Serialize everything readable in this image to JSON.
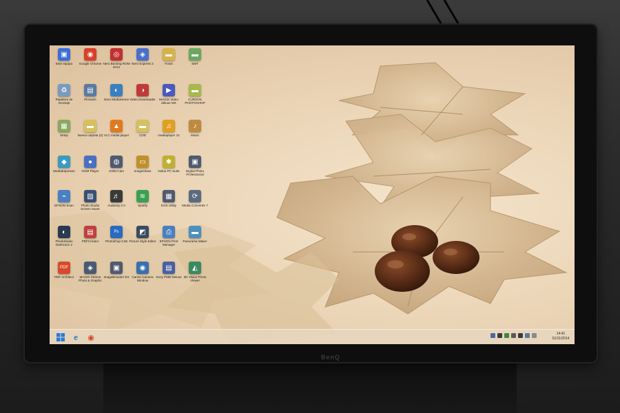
{
  "desktop": {
    "icons": [
      {
        "label": "Este equipo",
        "icon": "computer-icon",
        "color": "#3a6ed8",
        "glyph": "▣"
      },
      {
        "label": "Google Chrome",
        "icon": "chrome-icon",
        "color": "#d8402c",
        "glyph": "◉"
      },
      {
        "label": "Nero Burning ROM 2014",
        "icon": "disc-burn-icon",
        "color": "#c03030",
        "glyph": "◎"
      },
      {
        "label": "Nero Express 2",
        "icon": "nero-express-icon",
        "color": "#4a70c8",
        "glyph": "◈"
      },
      {
        "label": "Fotos",
        "icon": "folder-icon",
        "color": "#d6b34a",
        "glyph": "▬"
      },
      {
        "label": "SMT",
        "icon": "folder-icon",
        "color": "#6aa860",
        "glyph": "▬"
      },
      {
        "label": "Papelera de reciclaje",
        "icon": "recycle-bin-icon",
        "color": "#7a9bc0",
        "glyph": "♻"
      },
      {
        "label": "Pinnacle",
        "icon": "pinnacle-icon",
        "color": "#5a7aa0",
        "glyph": "▤"
      },
      {
        "label": "Nero MediaHome",
        "icon": "media-home-icon",
        "color": "#3a80c0",
        "glyph": "◐"
      },
      {
        "label": "Video Downloader",
        "icon": "video-downloader-icon",
        "color": "#c03a3a",
        "glyph": "◑"
      },
      {
        "label": "MAGIX Video deluxe MX",
        "icon": "magix-video-icon",
        "color": "#4a58c0",
        "glyph": "▶"
      },
      {
        "label": "CURSOS PHOTOSHOP",
        "icon": "folder-icon",
        "color": "#a8b84a",
        "glyph": "▬"
      },
      {
        "label": "Setup",
        "icon": "setup-icon",
        "color": "#8aa860",
        "glyph": "▦"
      },
      {
        "label": "Nueva carpeta (2)",
        "icon": "folder-icon",
        "color": "#d6c060",
        "glyph": "▬"
      },
      {
        "label": "VLC media player",
        "icon": "vlc-icon",
        "color": "#e07a20",
        "glyph": "▲"
      },
      {
        "label": "CDD",
        "icon": "folder-icon",
        "color": "#d6c060",
        "glyph": "▬"
      },
      {
        "label": "mediaplayer 12",
        "icon": "media-player-icon",
        "color": "#e0a020",
        "glyph": "♫"
      },
      {
        "label": "Music",
        "icon": "music-icon",
        "color": "#c08a40",
        "glyph": "♪"
      },
      {
        "label": "MediaEspresso",
        "icon": "media-espresso-icon",
        "color": "#3a9ac0",
        "glyph": "◆"
      },
      {
        "label": "GOM Player",
        "icon": "gom-player-icon",
        "color": "#4a70c0",
        "glyph": "●"
      },
      {
        "label": "GOM Cam",
        "icon": "gom-cam-icon",
        "color": "#505a70",
        "glyph": "◍"
      },
      {
        "label": "ImageGlass",
        "icon": "image-glass-icon",
        "color": "#c0902a",
        "glyph": "▭"
      },
      {
        "label": "Nokia PC Suite",
        "icon": "pc-suite-icon",
        "color": "#c0b030",
        "glyph": "✱"
      },
      {
        "label": "Digital Photo Professional",
        "icon": "photo-pro-icon",
        "color": "#505a70",
        "glyph": "▣"
      },
      {
        "label": "EPSON Scan",
        "icon": "scanner-icon",
        "color": "#4a80c0",
        "glyph": "⌁"
      },
      {
        "label": "Photo Studio Screen Saver",
        "icon": "screensaver-icon",
        "color": "#3a5070",
        "glyph": "▨"
      },
      {
        "label": "Audacity 2.0",
        "icon": "audio-editor-icon",
        "color": "#3a3a3a",
        "glyph": "♬"
      },
      {
        "label": "Spotify",
        "icon": "spotify-icon",
        "color": "#3aa050",
        "glyph": "≋"
      },
      {
        "label": "EOS Utility",
        "icon": "camera-utility-icon",
        "color": "#505a70",
        "glyph": "▦"
      },
      {
        "label": "Media Converter 7",
        "icon": "media-converter-icon",
        "color": "#5a6a80",
        "glyph": "⟳"
      },
      {
        "label": "PhotoStudio Darkroom 2",
        "icon": "darkroom-icon",
        "color": "#2a3a50",
        "glyph": "◐"
      },
      {
        "label": "PDFCreator",
        "icon": "pdf-creator-icon",
        "color": "#c04040",
        "glyph": "▤"
      },
      {
        "label": "Photoshop CS6",
        "icon": "photoshop-icon",
        "color": "#2a6ac0",
        "glyph": "Ps"
      },
      {
        "label": "Picture Style Editor",
        "icon": "style-editor-icon",
        "color": "#3a4a60",
        "glyph": "◩"
      },
      {
        "label": "EPSON Print Manager",
        "icon": "print-manager-icon",
        "color": "#4a80c0",
        "glyph": "⎙"
      },
      {
        "label": "Panorama Maker",
        "icon": "panorama-icon",
        "color": "#4a90c0",
        "glyph": "▬"
      },
      {
        "label": "PDF Architect",
        "icon": "pdf-architect-icon",
        "color": "#d84a2a",
        "glyph": "PDF"
      },
      {
        "label": "MAGIX Xtreme Photo & Graphic",
        "icon": "magix-photo-icon",
        "color": "#4a5a70",
        "glyph": "◈"
      },
      {
        "label": "ImageBrowser EX",
        "icon": "image-browser-icon",
        "color": "#505a70",
        "glyph": "▣"
      },
      {
        "label": "Canon Camera Window",
        "icon": "camera-window-icon",
        "color": "#3a70b0",
        "glyph": "◉"
      },
      {
        "label": "Sony PMB Deluxe",
        "icon": "pmb-icon",
        "color": "#4a60a0",
        "glyph": "▤"
      },
      {
        "label": "3D Vision Photo Viewer",
        "icon": "photo-viewer-icon",
        "color": "#3a8a60",
        "glyph": "◭"
      }
    ]
  },
  "taskbar": {
    "start_icon": "windows-start-icon",
    "pinned": [
      {
        "icon": "internet-explorer-icon",
        "glyph": "e",
        "color": "#2a7ad8"
      },
      {
        "icon": "chrome-icon",
        "glyph": "◉",
        "color": "#d8402c"
      }
    ],
    "tray_colors": [
      "#4a6aa0",
      "#3a3a3a",
      "#3a8a3a",
      "#5a5a5a",
      "#3a3a3a",
      "#5a7a9a",
      "#8a8a8a"
    ],
    "clock": {
      "time": "14:41",
      "date": "01/11/2014"
    }
  },
  "monitor": {
    "brand": "BenQ"
  }
}
